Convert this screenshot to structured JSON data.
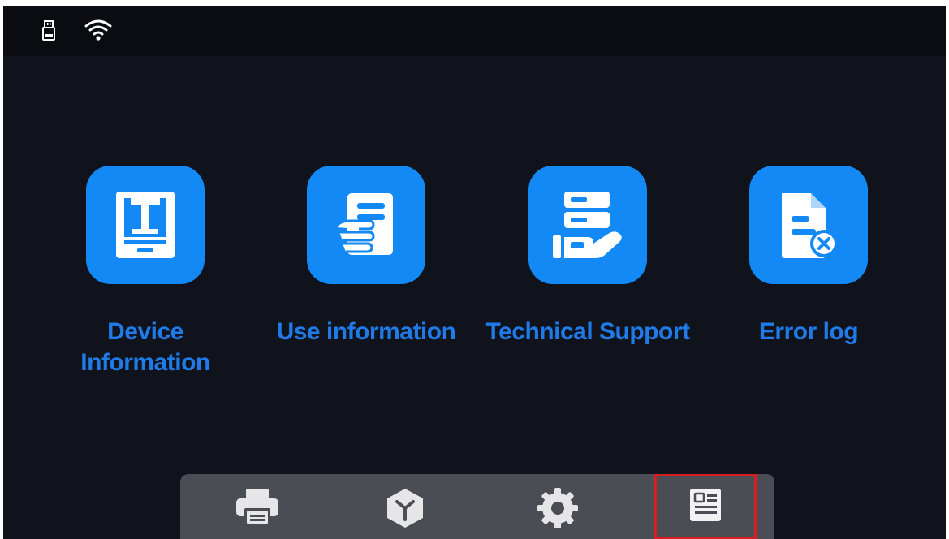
{
  "status_bar": {
    "icons": [
      "usb-drive-icon",
      "wifi-icon"
    ]
  },
  "tiles": [
    {
      "label": "Device\nInformation",
      "icon": "printer-frame-icon"
    },
    {
      "label": "Use information",
      "icon": "hand-document-icon"
    },
    {
      "label": "Technical Support",
      "icon": "server-hand-icon"
    },
    {
      "label": "Error log",
      "icon": "document-error-icon"
    }
  ],
  "bottom_nav": {
    "items": [
      {
        "icon": "printer-icon"
      },
      {
        "icon": "resin-cube-icon"
      },
      {
        "icon": "gear-icon"
      },
      {
        "icon": "info-document-icon",
        "active": true
      }
    ]
  },
  "colors": {
    "background": "#10121c",
    "tile_blue": "#1289f5",
    "label_blue": "#1f7be8",
    "nav_bar": "#4b4d55",
    "active_outline": "#d81e1e"
  }
}
